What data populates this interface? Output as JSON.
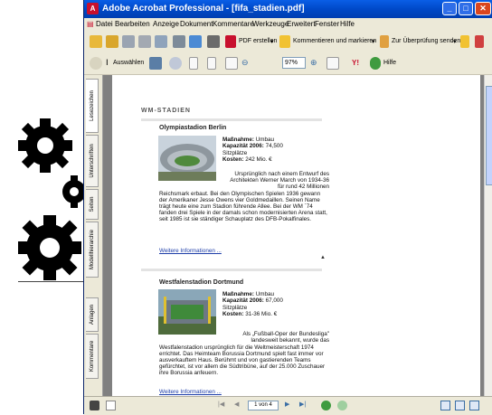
{
  "window": {
    "title": "Adobe Acrobat Professional - [fifa_stadien.pdf]",
    "controls": [
      "minimize",
      "maximize",
      "close"
    ]
  },
  "menu": [
    "Datei",
    "Bearbeiten",
    "Anzeige",
    "Dokument",
    "Kommentare",
    "Werkzeuge",
    "Erweitert",
    "Fenster",
    "Hilfe"
  ],
  "toolbar1": {
    "pdf_create": "PDF erstellen",
    "comment": "Kommentieren und markieren",
    "review": "Zur Überprüfung senden"
  },
  "toolbar2": {
    "select": "Auswählen",
    "zoom": "97%",
    "help": "Hilfe"
  },
  "side_tabs": [
    "Lesezeichen",
    "Unterschriften",
    "Seiten",
    "Modellhierarchie",
    "Anlagen",
    "Kommentare"
  ],
  "document": {
    "section_title": "WM-STADIEN",
    "stadiums": [
      {
        "name": "Olympiastadion Berlin",
        "measure_label": "Maßnahme:",
        "measure": "Umbau",
        "capacity_label": "Kapazität 2006:",
        "capacity": "74,500",
        "capacity_unit": "Sitzplätze",
        "cost_label": "Kosten:",
        "cost": "242 Mio. €",
        "text_side": "Ursprünglich nach einem Entwurf des Architekten Werner March von 1934-36 für rund 42 Millionen",
        "text_full": "Reichsmark erbaut. Bei den Olympischen Spielen 1936 gewann der Amerikaner Jesse Owens vier Goldmedaillen. Seinen Name trägt heute eine zum Stadion führende Allee. Bei der WM ´74 fanden drei Spiele in der damals schon modernisierten Arena statt, seit 1985 ist sie ständiger Schauplatz des DFB-Pokalfinales.",
        "more": "Weitere Informationen ..."
      },
      {
        "name": "Westfalenstadion Dortmund",
        "measure_label": "Maßnahme:",
        "measure": "Umbau",
        "capacity_label": "Kapazität 2006:",
        "capacity": "67,000",
        "capacity_unit": "Sitzplätze",
        "cost_label": "Kosten:",
        "cost": "31-36 Mio. €",
        "text_side": "Als „Fußball-Oper der Bundesliga\" landesweit bekannt, wurde das",
        "text_full": "Westfalenstadion ursprünglich für die Weltmeisterschaft 1974 errichtet. Das Heimteam Borussia Dortmund spielt fast immer vor ausverkauftem Haus. Berühmt und von gastierenden Teams gefürchtet, ist vor allem die Südtribüne, auf der 25.000 Zuschauer ihre Borussia anfeuern.",
        "more": "Weitere Informationen ..."
      }
    ]
  },
  "statusbar": {
    "page": "1 von 4"
  }
}
